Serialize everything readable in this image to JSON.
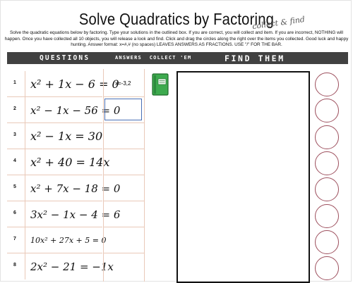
{
  "title": "Solve Quadratics by Factoring",
  "title_script": "collect & find",
  "instructions": "Solve the quadratic equations below by factoring. Type your solutions in the outlined box. If you are correct, you will collect and item. If you are incorrect, NOTHING will happen. Once you have collected all 10 objects, you will release a look and find. Click and drag the circles along the right over the items you collected. Good luck and happy hunting. Answer format: x=#,# (no spaces) LEAVES ANSWERS AS FRACTIONS. USE \"/\" FOR THE BAR.",
  "header": {
    "questions": "QUESTIONS",
    "answers": "ANSWERS",
    "collect": "COLLECT 'EM",
    "find": "FIND THEM"
  },
  "questions": [
    {
      "num": "1",
      "equation": "x² + 1x − 6 = 0",
      "answer": "x=-3,2"
    },
    {
      "num": "2",
      "equation": "x² − 1x − 56 = 0",
      "answer": ""
    },
    {
      "num": "3",
      "equation": "x² − 1x = 30",
      "answer": ""
    },
    {
      "num": "4",
      "equation": "x² + 40 = 14x",
      "answer": ""
    },
    {
      "num": "5",
      "equation": "x² + 7x − 18 = 0",
      "answer": ""
    },
    {
      "num": "6",
      "equation": "3x² − 1x − 4 = 6",
      "answer": ""
    },
    {
      "num": "7",
      "equation": "10x² + 27x + 5 = 0",
      "answer": ""
    },
    {
      "num": "8",
      "equation": "2x² − 21 = −1x",
      "answer": ""
    }
  ],
  "collected_item": "green-book-icon",
  "colors": {
    "header_bar": "#414141",
    "row_lines": "#e9c9b8",
    "circle_border": "#9d4f5d",
    "active_input_border": "#4a6fb5",
    "book_green": "#3daa4e"
  }
}
